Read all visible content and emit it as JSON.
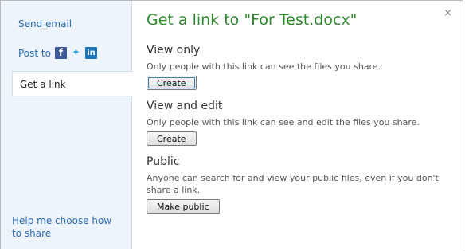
{
  "sidebar": {
    "send_email": "Send email",
    "post_to": "Post to",
    "social_icons": [
      "facebook-icon",
      "twitter-icon",
      "linkedin-icon"
    ],
    "get_a_link": "Get a link",
    "help": "Help me choose how to share"
  },
  "dialog": {
    "title": "Get a link to \"For Test.docx\"",
    "close": "×"
  },
  "sections": {
    "view_only": {
      "title": "View only",
      "description": "Only people with this link can see the files you share.",
      "button": "Create"
    },
    "view_edit": {
      "title": "View and edit",
      "description": "Only people with this link can see and edit the files you share.",
      "button": "Create"
    },
    "public": {
      "title": "Public",
      "description": "Anyone can search for and view your public files, even if you don't share a link.",
      "button": "Make public"
    }
  },
  "colors": {
    "title_green": "#2c8a2c",
    "link_blue": "#2b6cb6",
    "sidebar_bg": "#eef4fb"
  }
}
